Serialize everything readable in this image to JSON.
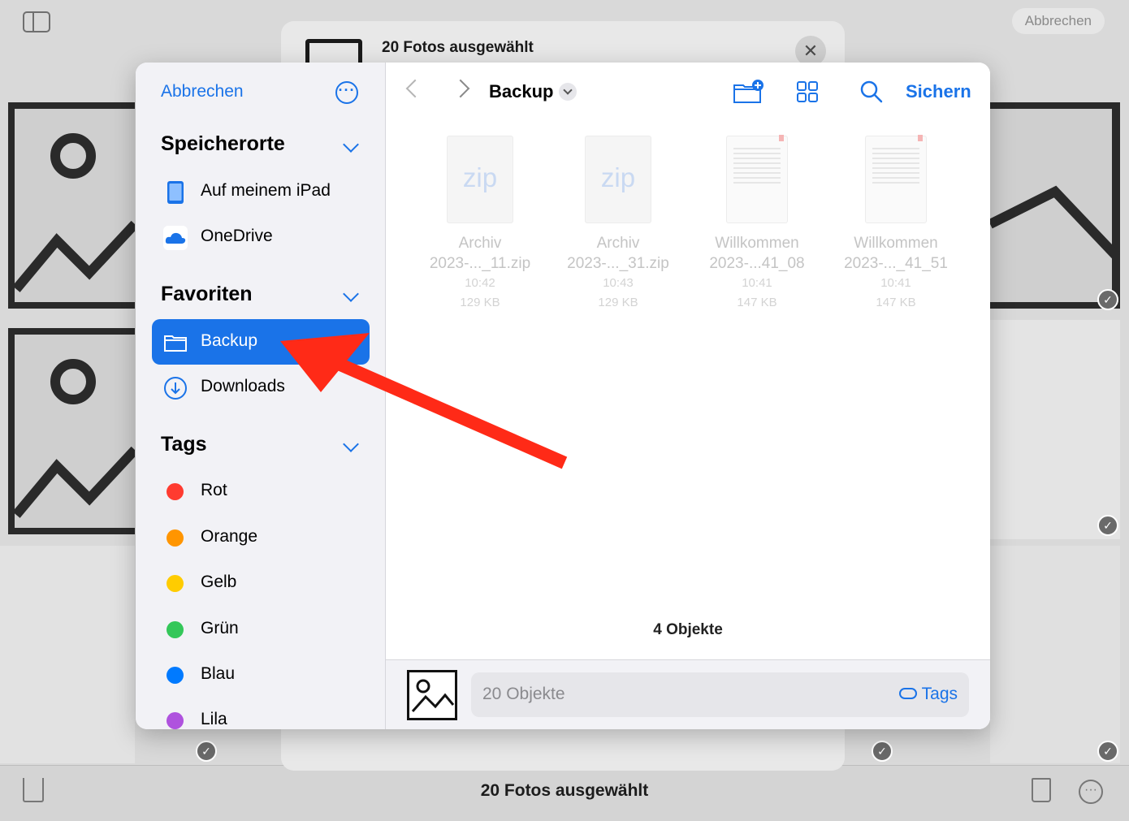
{
  "background": {
    "cancel_label": "Abbrechen",
    "bottom_title": "20 Fotos ausgewählt"
  },
  "share_sheet": {
    "title": "20 Fotos ausgewählt",
    "close_icon": "close-icon"
  },
  "sidebar": {
    "cancel_label": "Abbrechen",
    "more_icon": "ellipsis-circle-icon",
    "sections": {
      "locations": {
        "title": "Speicherorte",
        "items": [
          {
            "label": "Auf meinem iPad",
            "icon": "ipad-icon"
          },
          {
            "label": "OneDrive",
            "icon": "onedrive-icon"
          }
        ]
      },
      "favorites": {
        "title": "Favoriten",
        "items": [
          {
            "label": "Backup",
            "icon": "folder-icon",
            "selected": true
          },
          {
            "label": "Downloads",
            "icon": "download-circle-icon"
          }
        ]
      },
      "tags": {
        "title": "Tags",
        "items": [
          {
            "label": "Rot",
            "color": "#ff3b30"
          },
          {
            "label": "Orange",
            "color": "#ff9500"
          },
          {
            "label": "Gelb",
            "color": "#ffcc00"
          },
          {
            "label": "Grün",
            "color": "#34c759"
          },
          {
            "label": "Blau",
            "color": "#007aff"
          },
          {
            "label": "Lila",
            "color": "#af52de"
          }
        ]
      }
    }
  },
  "browser": {
    "title": "Backup",
    "save_label": "Sichern",
    "files": [
      {
        "ext": "zip",
        "name1": "Archiv",
        "name2": "2023-..._11.zip",
        "time": "10:42",
        "size": "129 KB"
      },
      {
        "ext": "zip",
        "name1": "Archiv",
        "name2": "2023-..._31.zip",
        "time": "10:43",
        "size": "129 KB"
      },
      {
        "ext": "",
        "name1": "Willkommen",
        "name2": "2023-...41_08",
        "time": "10:41",
        "size": "147 KB"
      },
      {
        "ext": "",
        "name1": "Willkommen",
        "name2": "2023-..._41_51",
        "time": "10:41",
        "size": "147 KB"
      }
    ],
    "count_label": "4 Objekte",
    "footer": {
      "field_text": "20 Objekte",
      "tags_label": "Tags"
    }
  },
  "colors": {
    "accent": "#1a73e8",
    "annotation_arrow": "#ff2a17"
  }
}
